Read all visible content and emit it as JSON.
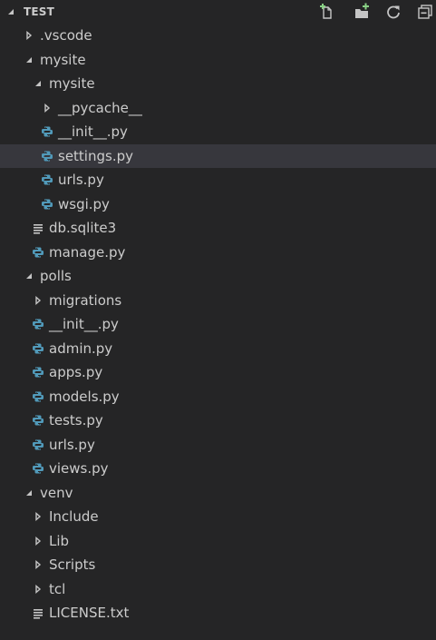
{
  "explorer": {
    "header": {
      "title": "TEST",
      "actions": [
        {
          "name": "new-file-icon",
          "tooltip": "New File"
        },
        {
          "name": "new-folder-icon",
          "tooltip": "New Folder"
        },
        {
          "name": "refresh-icon",
          "tooltip": "Refresh"
        },
        {
          "name": "collapse-all-icon",
          "tooltip": "Collapse All"
        }
      ]
    },
    "tree": [
      {
        "label": ".vscode",
        "kind": "folder",
        "expanded": false,
        "depth": 1
      },
      {
        "label": "mysite",
        "kind": "folder",
        "expanded": true,
        "depth": 1
      },
      {
        "label": "mysite",
        "kind": "folder",
        "expanded": true,
        "depth": 2
      },
      {
        "label": "__pycache__",
        "kind": "folder",
        "expanded": false,
        "depth": 3
      },
      {
        "label": "__init__.py",
        "kind": "python",
        "depth": 3
      },
      {
        "label": "settings.py",
        "kind": "python",
        "depth": 3,
        "selected": true
      },
      {
        "label": "urls.py",
        "kind": "python",
        "depth": 3
      },
      {
        "label": "wsgi.py",
        "kind": "python",
        "depth": 3
      },
      {
        "label": "db.sqlite3",
        "kind": "text",
        "depth": 2
      },
      {
        "label": "manage.py",
        "kind": "python",
        "depth": 2
      },
      {
        "label": "polls",
        "kind": "folder",
        "expanded": true,
        "depth": 1
      },
      {
        "label": "migrations",
        "kind": "folder",
        "expanded": false,
        "depth": 2
      },
      {
        "label": "__init__.py",
        "kind": "python",
        "depth": 2
      },
      {
        "label": "admin.py",
        "kind": "python",
        "depth": 2
      },
      {
        "label": "apps.py",
        "kind": "python",
        "depth": 2
      },
      {
        "label": "models.py",
        "kind": "python",
        "depth": 2
      },
      {
        "label": "tests.py",
        "kind": "python",
        "depth": 2
      },
      {
        "label": "urls.py",
        "kind": "python",
        "depth": 2
      },
      {
        "label": "views.py",
        "kind": "python",
        "depth": 2
      },
      {
        "label": "venv",
        "kind": "folder",
        "expanded": true,
        "depth": 1
      },
      {
        "label": "Include",
        "kind": "folder",
        "expanded": false,
        "depth": 2
      },
      {
        "label": "Lib",
        "kind": "folder",
        "expanded": false,
        "depth": 2
      },
      {
        "label": "Scripts",
        "kind": "folder",
        "expanded": false,
        "depth": 2
      },
      {
        "label": "tcl",
        "kind": "folder",
        "expanded": false,
        "depth": 2
      },
      {
        "label": "LICENSE.txt",
        "kind": "text",
        "depth": 2
      }
    ]
  },
  "colors": {
    "background": "#252526",
    "selection": "#37373d",
    "text": "#cccccc",
    "python_icon_blue": "#519aba",
    "icon_gray": "#c5c5c5"
  }
}
